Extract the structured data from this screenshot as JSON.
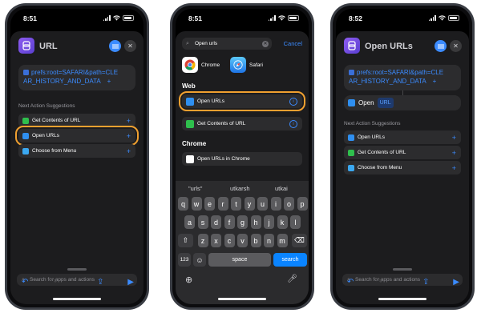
{
  "phone1": {
    "time": "8:51",
    "title": "URL",
    "url_line1": "prefs:root=SAFARI&path=CLE",
    "url_line2": "AR_HISTORY_AND_DATA",
    "url_plus": "+",
    "suggestions_header": "Next Action Suggestions",
    "suggestions": [
      {
        "label": "Get Contents of URL",
        "icon_color": "#2fbf4d"
      },
      {
        "label": "Open URLs",
        "icon_color": "#2f8ff0"
      },
      {
        "label": "Choose from Menu",
        "icon_color": "#3ba8f0"
      }
    ],
    "plus": "+",
    "search_placeholder": "Search for apps and actions"
  },
  "phone2": {
    "time": "8:51",
    "search_value": "Open urls",
    "cancel": "Cancel",
    "apps": [
      "Chrome",
      "Safari"
    ],
    "web_header": "Web",
    "web_items": [
      "Open URLs",
      "Get Contents of URL"
    ],
    "chrome_header": "Chrome",
    "chrome_items": [
      "Open URLs in Chrome"
    ],
    "predictions": [
      "\"urls\"",
      "utkarsh",
      "utkai"
    ],
    "row1": [
      "q",
      "w",
      "e",
      "r",
      "t",
      "y",
      "u",
      "i",
      "o",
      "p"
    ],
    "row2": [
      "a",
      "s",
      "d",
      "f",
      "g",
      "h",
      "j",
      "k",
      "l"
    ],
    "row3": [
      "z",
      "x",
      "c",
      "v",
      "b",
      "n",
      "m"
    ],
    "key_123": "123",
    "space": "space",
    "search": "search",
    "info_glyph": "i"
  },
  "phone3": {
    "time": "8:52",
    "title": "Open URLs",
    "url_line1": "prefs:root=SAFARI&path=CLE",
    "url_line2": "AR_HISTORY_AND_DATA",
    "url_plus": "+",
    "open_label": "Open",
    "url_token": "URL",
    "suggestions_header": "Next Action Suggestions",
    "suggestions": [
      {
        "label": "Open URLs",
        "icon_color": "#2f8ff0"
      },
      {
        "label": "Get Contents of URL",
        "icon_color": "#2fbf4d"
      },
      {
        "label": "Choose from Menu",
        "icon_color": "#3ba8f0"
      }
    ],
    "plus": "+",
    "search_placeholder": "Search for apps and actions"
  },
  "colors": {
    "accent": "#3b8bff",
    "highlight": "#f0a030",
    "sheet": "#1c1c1e"
  }
}
